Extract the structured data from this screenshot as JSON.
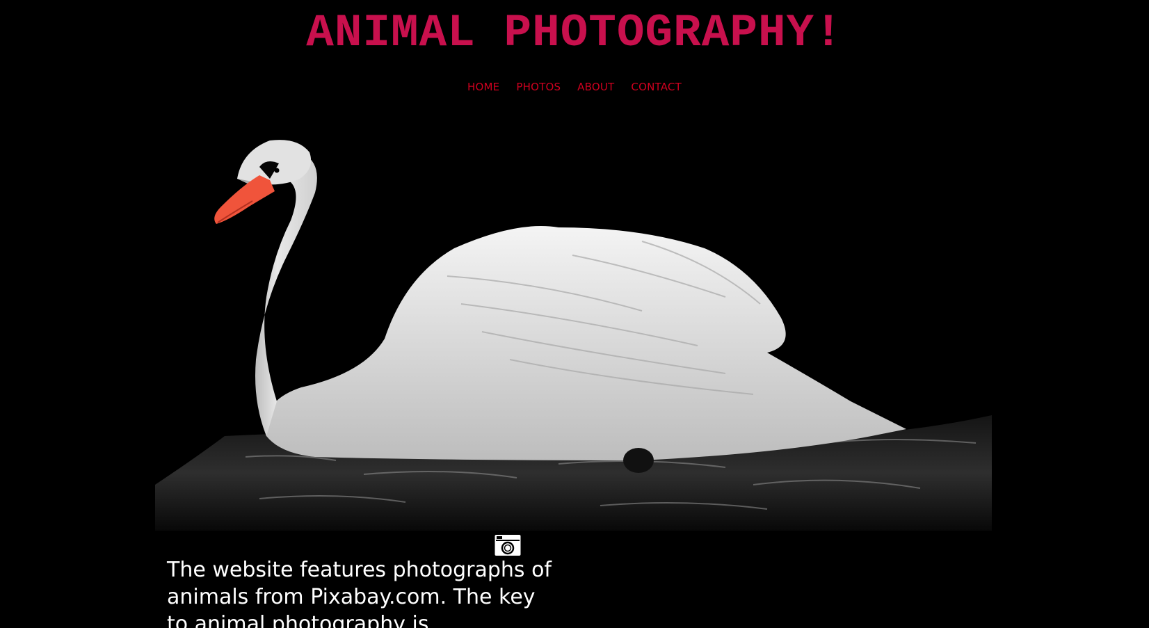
{
  "site": {
    "title": "ANIMAL PHOTOGRAPHY!",
    "title_color": "#c8104d"
  },
  "nav": {
    "link_color": "#d0001f",
    "items": [
      {
        "label": "HOME"
      },
      {
        "label": "PHOTOS"
      },
      {
        "label": "ABOUT"
      },
      {
        "label": "CONTACT"
      }
    ]
  },
  "hero": {
    "image_subject": "white swan swimming on dark water"
  },
  "camera_icon": "camera-icon",
  "intro": {
    "text": "The website features photographs of animals from Pixabay.com. The key to animal photography is"
  }
}
